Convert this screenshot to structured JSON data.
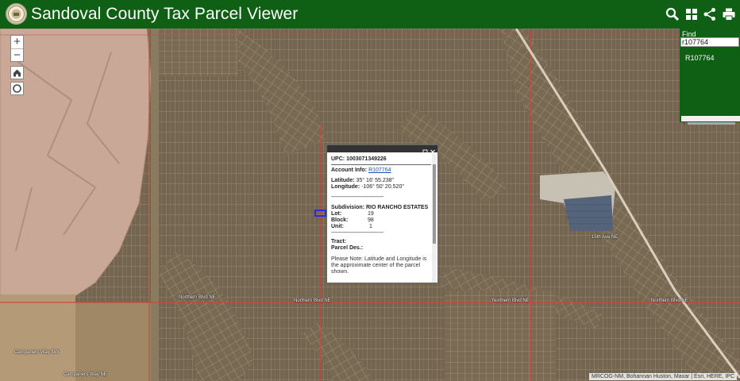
{
  "header": {
    "title": "Sandoval County Tax Parcel Viewer",
    "colors": {
      "bar": "#0f5f14",
      "title": "#ffffff"
    },
    "tools": [
      "search-icon",
      "basemap-gallery-icon",
      "share-icon",
      "print-icon"
    ]
  },
  "map_controls": {
    "zoom_in": "+",
    "zoom_out": "−",
    "home": "home-icon",
    "locate": "locate-icon"
  },
  "find": {
    "label": "Find",
    "value": "r107764",
    "result": "R107764"
  },
  "popup": {
    "upc_label": "UPC:",
    "upc_value": "1003071349226",
    "account_label": "Account Info:",
    "account_value": "R107764",
    "latitude_label": "Latitude:",
    "latitude_value": "35° 16' 55.238\"",
    "longitude_label": "Longitude:",
    "longitude_value": "-106° 50' 20.520\"",
    "separator": "------------------------------------",
    "subdivision_label": "Subdivision:",
    "subdivision_value": "RIO RANCHO ESTATES",
    "lot_label": "Lot:",
    "lot_value": "19",
    "block_label": "Block:",
    "block_value": "98",
    "unit_label": "Unit:",
    "unit_value": "1",
    "tract_label": "Tract:",
    "tract_value": "",
    "parcel_label": "Parcel Des.:",
    "parcel_value": "",
    "note": "Please Note: Latitude and Longitude is the approximate center of the parcel shown."
  },
  "map": {
    "road_labels": [
      "Northern Blvd NE",
      "Northern Blvd NE",
      "Northern Blvd NE",
      "Northern Blvd NE",
      "15th Ave NE",
      "Campanero Way NW",
      "Campanero Way NE"
    ],
    "colors": {
      "terrain": "#7c6d59",
      "road": "#c84a3a",
      "parcel_highlight": "#2a2ae8"
    }
  },
  "attribution": "MRCOG-NM, Bohannan Huston, Maxar | Esri, HERE, IPC"
}
